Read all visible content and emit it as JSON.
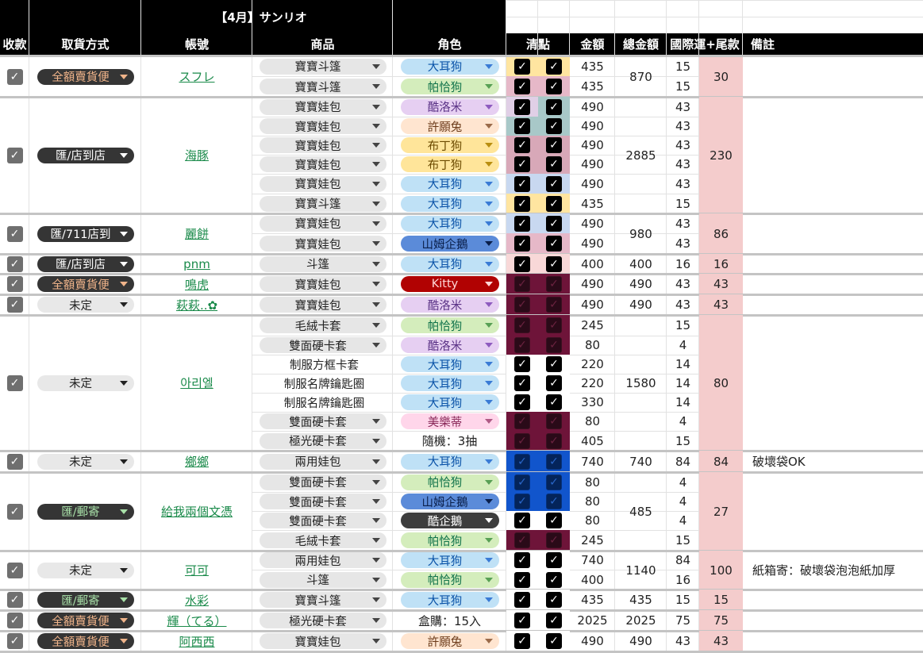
{
  "title": "【4月】サンリオ",
  "headers": {
    "received": "收款",
    "pickup": "取貨方式",
    "account": "帳號",
    "product": "商品",
    "character": "角色",
    "check": "清點",
    "amount": "金額",
    "total": "總金額",
    "shipping": "國際運+尾款",
    "note": "備註"
  },
  "colors": {
    "header_bg": "#000000",
    "balance_bg": "#f4cccc",
    "check_black": "#000000",
    "check_dark": "#6e1439",
    "check_navy": "#1155cc"
  },
  "groups": [
    {
      "pickup": "全額賣貨便",
      "account": "スフレ",
      "total": "870",
      "balance": "30",
      "note": "",
      "rows": [
        {
          "product": "寶寶斗篷",
          "char": "大耳狗",
          "amount": "435",
          "ship": "15"
        },
        {
          "product": "寶寶斗篷",
          "char": "帕恰狗",
          "amount": "435",
          "ship": "15"
        }
      ]
    },
    {
      "pickup": "匯/店到店",
      "account": "海豚",
      "total": "2885",
      "balance": "230",
      "note": "",
      "rows": [
        {
          "product": "寶寶娃包",
          "char": "酷洛米",
          "amount": "490",
          "ship": "43"
        },
        {
          "product": "寶寶娃包",
          "char": "許願兔",
          "amount": "490",
          "ship": "43"
        },
        {
          "product": "寶寶娃包",
          "char": "布丁狗",
          "amount": "490",
          "ship": "43"
        },
        {
          "product": "寶寶娃包",
          "char": "布丁狗",
          "amount": "490",
          "ship": "43"
        },
        {
          "product": "寶寶娃包",
          "char": "大耳狗",
          "amount": "490",
          "ship": "43"
        },
        {
          "product": "寶寶斗篷",
          "char": "大耳狗",
          "amount": "435",
          "ship": "15"
        }
      ]
    },
    {
      "pickup": "匯/711店到",
      "account": "麗餅",
      "total": "980",
      "balance": "86",
      "note": "",
      "rows": [
        {
          "product": "寶寶娃包",
          "char": "大耳狗",
          "amount": "490",
          "ship": "43"
        },
        {
          "product": "寶寶娃包",
          "char": "山姆企鵝",
          "amount": "490",
          "ship": "43"
        }
      ]
    },
    {
      "pickup": "匯/店到店",
      "account": "pnm",
      "total": "400",
      "balance": "16",
      "note": "",
      "rows": [
        {
          "product": "斗篷",
          "char": "大耳狗",
          "amount": "400",
          "ship": "16"
        }
      ]
    },
    {
      "pickup": "全額賣貨便",
      "account": "鳴虎",
      "total": "490",
      "balance": "43",
      "note": "",
      "rows": [
        {
          "product": "寶寶娃包",
          "char": "Kitty",
          "amount": "490",
          "ship": "43"
        }
      ]
    },
    {
      "pickup": "未定",
      "account": "萩萩..✿",
      "total": "490",
      "balance": "43",
      "note": "",
      "rows": [
        {
          "product": "寶寶娃包",
          "char": "酷洛米",
          "amount": "490",
          "ship": "43"
        }
      ]
    },
    {
      "pickup": "未定",
      "account": "아리엘",
      "total": "1580",
      "balance": "80",
      "note": "",
      "rows": [
        {
          "product": "毛絨卡套",
          "char": "帕恰狗",
          "amount": "245",
          "ship": "15"
        },
        {
          "product": "雙面硬卡套",
          "char": "酷洛米",
          "amount": "80",
          "ship": "4"
        },
        {
          "product": "制服方框卡套",
          "char": "大耳狗",
          "amount": "220",
          "ship": "14"
        },
        {
          "product": "制服名牌鑰匙圈",
          "char": "大耳狗",
          "amount": "220",
          "ship": "14"
        },
        {
          "product": "制服名牌鑰匙圈",
          "char": "大耳狗",
          "amount": "330",
          "ship": "14"
        },
        {
          "product": "雙面硬卡套",
          "char": "美樂蒂",
          "amount": "80",
          "ship": "4"
        },
        {
          "product": "極光硬卡套",
          "char": "隨機：3抽",
          "amount": "405",
          "ship": "15"
        }
      ]
    },
    {
      "pickup": "未定",
      "account": "鄉鄉",
      "total": "740",
      "balance": "84",
      "note": "破壞袋OK",
      "rows": [
        {
          "product": "兩用娃包",
          "char": "大耳狗",
          "amount": "740",
          "ship": "84"
        }
      ]
    },
    {
      "pickup": "匯/郵寄",
      "account": "給我兩個文憑",
      "total": "485",
      "balance": "27",
      "note": "",
      "rows": [
        {
          "product": "雙面硬卡套",
          "char": "帕恰狗",
          "amount": "80",
          "ship": "4"
        },
        {
          "product": "雙面硬卡套",
          "char": "山姆企鵝",
          "amount": "80",
          "ship": "4"
        },
        {
          "product": "雙面硬卡套",
          "char": "酷企鵝",
          "amount": "80",
          "ship": "4"
        },
        {
          "product": "毛絨卡套",
          "char": "帕恰狗",
          "amount": "245",
          "ship": "15"
        }
      ]
    },
    {
      "pickup": "未定",
      "account": "可可",
      "total": "1140",
      "balance": "100",
      "note": "紙箱寄：破壞袋泡泡紙加厚",
      "rows": [
        {
          "product": "兩用娃包",
          "char": "大耳狗",
          "amount": "740",
          "ship": "84"
        },
        {
          "product": "斗篷",
          "char": "帕恰狗",
          "amount": "400",
          "ship": "16"
        }
      ]
    },
    {
      "pickup": "匯/郵寄",
      "account": "水彩",
      "total": "435",
      "balance": "15",
      "note": "",
      "rows": [
        {
          "product": "寶寶斗篷",
          "char": "大耳狗",
          "amount": "435",
          "ship": "15"
        }
      ]
    },
    {
      "pickup": "全額賣貨便",
      "account": "輝（てる）",
      "total": "2025",
      "balance": "75",
      "note": "",
      "rows": [
        {
          "product": "極光硬卡套",
          "char": "盒購：15入",
          "amount": "2025",
          "ship": "75"
        }
      ]
    },
    {
      "pickup": "全額賣貨便",
      "account": "阿西西",
      "total": "490",
      "balance": "43",
      "note": "",
      "rows": [
        {
          "product": "寶寶娃包",
          "char": "許願兔",
          "amount": "490",
          "ship": "43"
        }
      ]
    }
  ]
}
